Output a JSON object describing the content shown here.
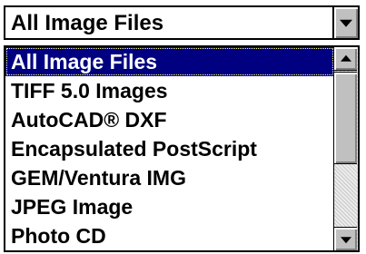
{
  "combo": {
    "selected_value": "All Image Files",
    "button_icon": "chevron-down-icon"
  },
  "list": {
    "selected_index": 0,
    "items": [
      {
        "label": "All Image Files"
      },
      {
        "label": "TIFF 5.0 Images"
      },
      {
        "label": "AutoCAD® DXF"
      },
      {
        "label": "Encapsulated PostScript"
      },
      {
        "label": "GEM/Ventura IMG"
      },
      {
        "label": "JPEG Image"
      },
      {
        "label": "Photo CD"
      }
    ]
  },
  "scrollbar": {
    "up_icon": "arrow-up-icon",
    "down_icon": "arrow-down-icon",
    "scroll_position": 0
  },
  "colors": {
    "selection_bg": "#000080",
    "selection_fg": "#ffffff",
    "button_face": "#c0c0c0"
  }
}
